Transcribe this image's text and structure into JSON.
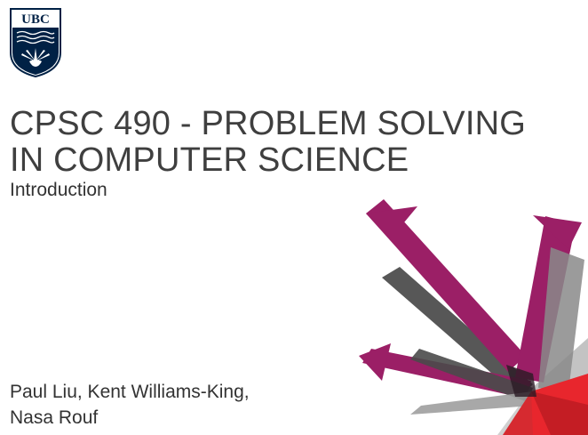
{
  "logo": {
    "text": "UBC"
  },
  "title": {
    "line1": "CPSC 490 - PROBLEM SOLVING",
    "line2": "IN COMPUTER SCIENCE"
  },
  "subtitle": "Introduction",
  "authors": {
    "line1": "Paul Liu, Kent Williams-King,",
    "line2": "Nasa Rouf"
  },
  "colors": {
    "ubc_navy": "#002145",
    "arrow_magenta": "#9b1f66",
    "arrow_dark": "#3a3a3a",
    "arrow_gray": "#9e9e9e",
    "accent_red": "#e8262d",
    "title_text": "#3f3f3f"
  }
}
